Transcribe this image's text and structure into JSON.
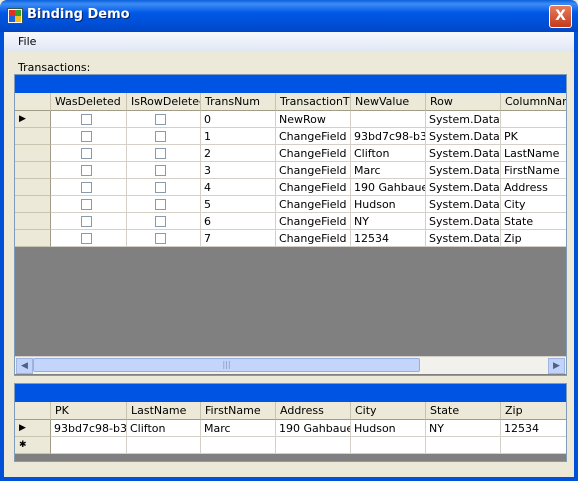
{
  "window": {
    "title": "Binding Demo",
    "close_glyph": "X"
  },
  "menu": {
    "file": "File"
  },
  "transactions_label": "Transactions:",
  "grid1": {
    "columns": [
      "WasDeleted",
      "IsRowDeleted",
      "TransNum",
      "TransactionT",
      "NewValue",
      "Row",
      "ColumnNam"
    ],
    "rows": [
      {
        "trans": "0",
        "type": "NewRow",
        "value": "",
        "row": "System.Data.",
        "col": ""
      },
      {
        "trans": "1",
        "type": "ChangeField",
        "value": "93bd7c98-b3",
        "row": "System.Data.",
        "col": "PK"
      },
      {
        "trans": "2",
        "type": "ChangeField",
        "value": "Clifton",
        "row": "System.Data.",
        "col": "LastName"
      },
      {
        "trans": "3",
        "type": "ChangeField",
        "value": "Marc",
        "row": "System.Data.",
        "col": "FirstName"
      },
      {
        "trans": "4",
        "type": "ChangeField",
        "value": "190 Gahbaue",
        "row": "System.Data.",
        "col": "Address"
      },
      {
        "trans": "5",
        "type": "ChangeField",
        "value": "Hudson",
        "row": "System.Data.",
        "col": "City"
      },
      {
        "trans": "6",
        "type": "ChangeField",
        "value": "NY",
        "row": "System.Data.",
        "col": "State"
      },
      {
        "trans": "7",
        "type": "ChangeField",
        "value": "12534",
        "row": "System.Data.",
        "col": "Zip"
      }
    ],
    "current_row_marker": "▶"
  },
  "grid2": {
    "columns": [
      "PK",
      "LastName",
      "FirstName",
      "Address",
      "City",
      "State",
      "Zip"
    ],
    "rows": [
      {
        "pk": "93bd7c98-b3",
        "last": "Clifton",
        "first": "Marc",
        "address": "190 Gahbaue",
        "city": "Hudson",
        "state": "NY",
        "zip": "12534"
      }
    ],
    "current_row_marker": "▶",
    "new_row_marker": "✱"
  },
  "colors": {
    "caption": "#0054e3",
    "title_bar": "#0050d8",
    "grid_background": "#808080"
  },
  "icons": {
    "app": "app-icon",
    "close": "close-icon",
    "left": "scroll-left-icon",
    "right": "scroll-right-icon"
  }
}
